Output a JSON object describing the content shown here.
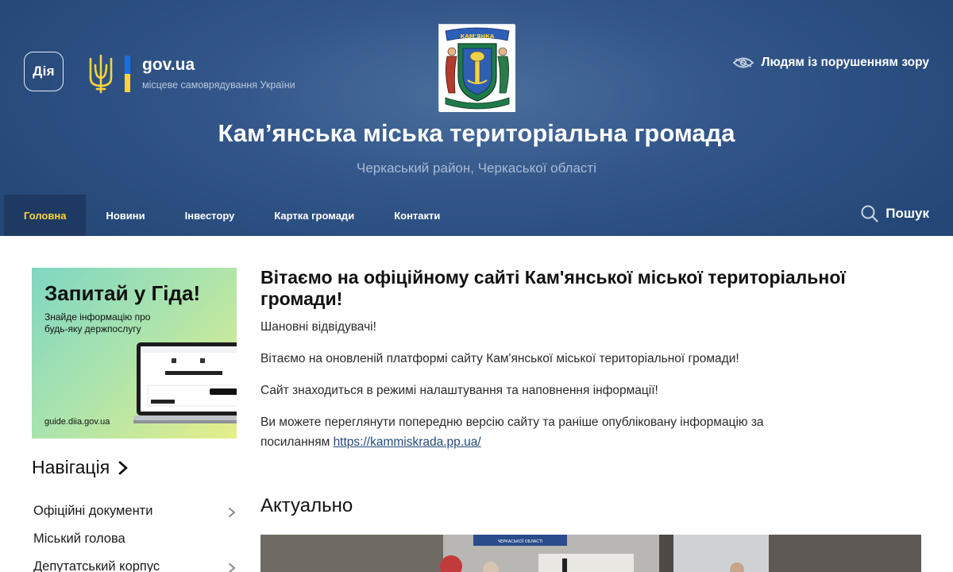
{
  "header": {
    "diia_label": "Дія",
    "govua_title": "gov.ua",
    "govua_subtitle": "місцеве самоврядування України",
    "vision_link": "Людям із порушенням зору",
    "site_title": "Кам’янська міська територіальна громада",
    "site_subtitle": "Черкаський район, Черкаської області",
    "search_label": "Пошук",
    "emblem_text": "КАМ'ЯНКА",
    "nav": [
      {
        "label": "Головна",
        "active": true
      },
      {
        "label": "Новини",
        "active": false
      },
      {
        "label": "Інвестору",
        "active": false
      },
      {
        "label": "Картка громади",
        "active": false
      },
      {
        "label": "Контакти",
        "active": false
      }
    ],
    "colors": {
      "header_bg": "#2f5486",
      "active_nav": "#ffd43b",
      "flag_blue": "#1a6ee0",
      "flag_yellow": "#ffd43b"
    }
  },
  "sidebar": {
    "banner": {
      "title": "Запитай у Гіда!",
      "subtitle": "Знайде інформацію про будь-яку держпослугу",
      "url": "guide.diia.gov.ua"
    },
    "nav_heading": "Навігація",
    "items": [
      {
        "label": "Офіційні документи",
        "has_children": true
      },
      {
        "label": "Міський голова",
        "has_children": false
      },
      {
        "label": "Депутатський корпус",
        "has_children": true
      }
    ]
  },
  "main": {
    "welcome_title": "Вітаємо на офіційному сайті Кам'янської міської територіальної громади!",
    "paragraphs": [
      "Шановні відвідувачі!",
      "Вітаємо на оновленій платформі сайту Кам'янської міської територіальної громади!",
      "Сайт знаходиться в режимі налаштування та наповнення інформації!"
    ],
    "last_paragraph_text": "Ви можете переглянути попередню версію сайту та раніше опубліковану інформацію за посиланням ",
    "last_paragraph_link": "https://kammiskrada.pp.ua/",
    "section_title": "Актуально",
    "news_image_sign": "ЧЕРКАСЬКОЇ ОБЛАСТІ"
  }
}
